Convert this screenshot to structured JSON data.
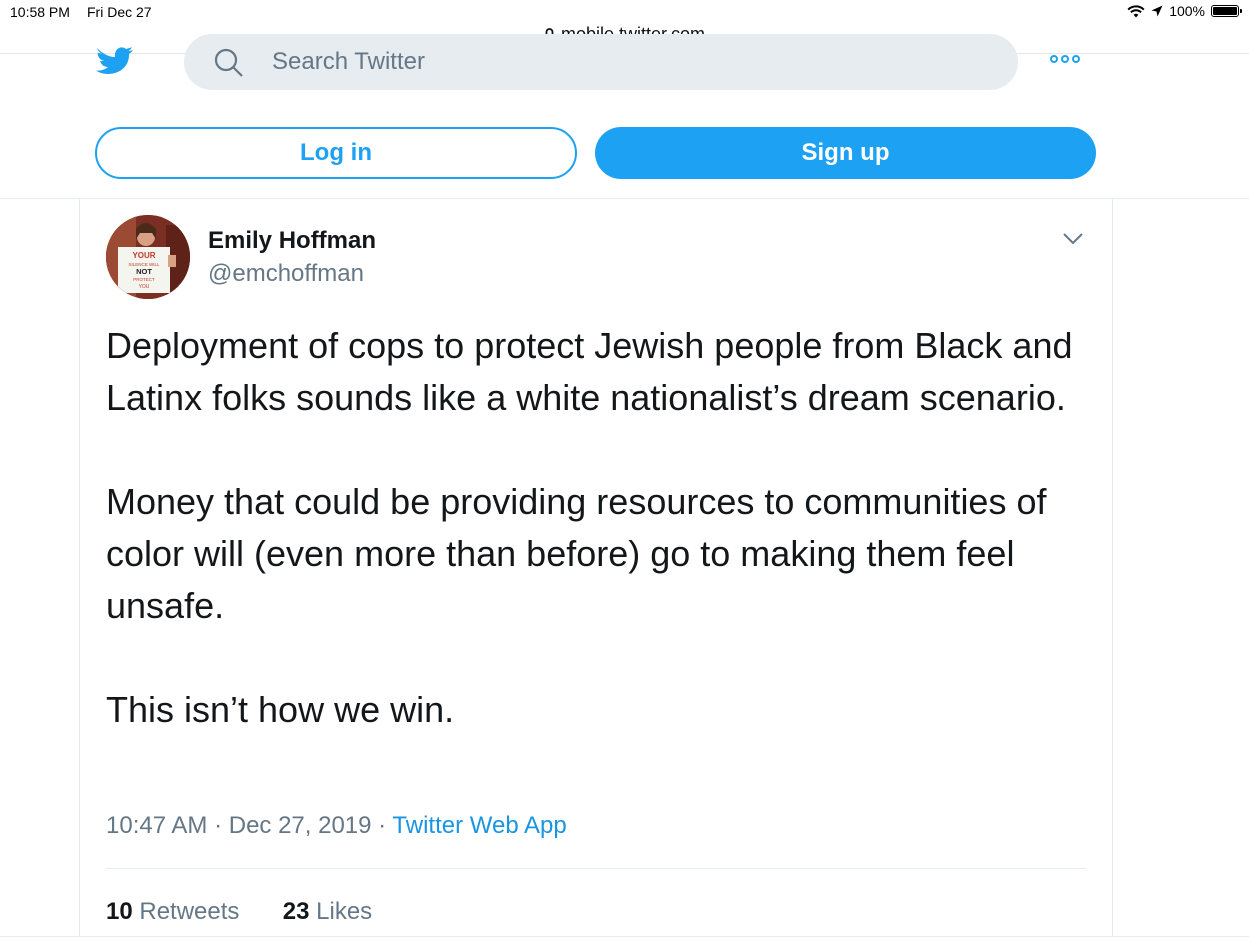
{
  "status_bar": {
    "time": "10:58 PM",
    "date": "Fri Dec 27",
    "battery": "100%"
  },
  "browser": {
    "url": "mobile.twitter.com"
  },
  "header": {
    "search_placeholder": "Search Twitter",
    "login_label": "Log in",
    "signup_label": "Sign up"
  },
  "tweet": {
    "name": "Emily Hoffman",
    "handle": "@emchoffman",
    "avatar_sign": [
      "YOUR",
      "SILENCE WILL",
      "NOT",
      "PROTECT",
      "YOU"
    ],
    "paragraphs": [
      "Deployment of cops to protect Jewish people from Black and Latinx folks sounds like a white nationalist’s dream scenario.",
      "Money that could be providing resources to communities of color will (even more than before) go to making them feel unsafe.",
      "This isn’t how we win."
    ],
    "time": "10:47 AM",
    "date": "Dec 27, 2019",
    "source": "Twitter Web App",
    "retweets_count": "10",
    "retweets_label": "Retweets",
    "likes_count": "23",
    "likes_label": "Likes"
  },
  "colors": {
    "accent": "#1da1f2",
    "secondary_text": "#657786",
    "search_bg": "#e6ecf0"
  }
}
